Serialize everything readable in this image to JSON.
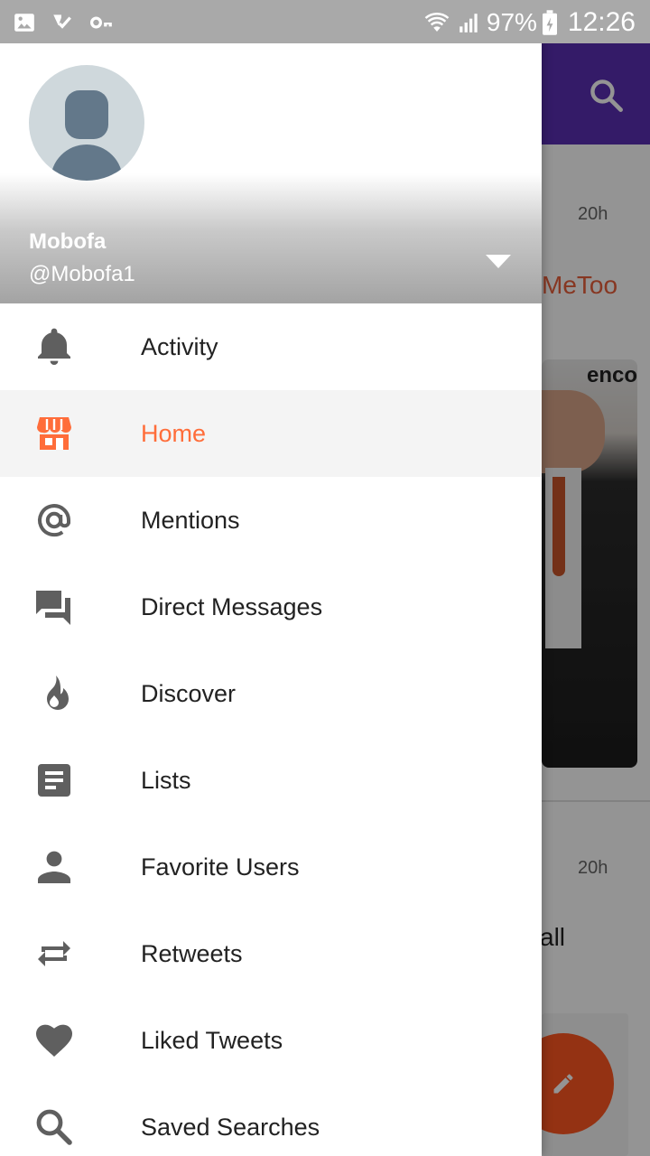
{
  "status_bar": {
    "battery_percent": "97%",
    "time": "12:26",
    "icons": [
      "image-icon",
      "check-icon",
      "key-icon",
      "wifi-icon",
      "signal-icon",
      "battery-charging-icon"
    ]
  },
  "background": {
    "search_icon": "search-icon",
    "timestamp_1": "20h",
    "hashtag_text": "MeToo",
    "photo_logo_text": "enco",
    "timestamp_2": "20h",
    "text_fragment": "all",
    "compose_icon": "pencil-icon"
  },
  "drawer": {
    "user": {
      "name": "Mobofa",
      "handle": "@Mobofa1"
    },
    "menu": [
      {
        "label": "Activity",
        "icon": "bell-icon",
        "active": false
      },
      {
        "label": "Home",
        "icon": "store-icon",
        "active": true
      },
      {
        "label": "Mentions",
        "icon": "at-icon",
        "active": false
      },
      {
        "label": "Direct Messages",
        "icon": "chat-icon",
        "active": false
      },
      {
        "label": "Discover",
        "icon": "flame-icon",
        "active": false
      },
      {
        "label": "Lists",
        "icon": "list-icon",
        "active": false
      },
      {
        "label": "Favorite Users",
        "icon": "person-icon",
        "active": false
      },
      {
        "label": "Retweets",
        "icon": "repeat-icon",
        "active": false
      },
      {
        "label": "Liked Tweets",
        "icon": "heart-icon",
        "active": false
      },
      {
        "label": "Saved Searches",
        "icon": "search-icon",
        "active": false
      }
    ]
  },
  "colors": {
    "accent": "#ff6d3a",
    "toolbar": "#5b2fb3",
    "icon_gray": "#5f5f5f",
    "fab": "#ff5722"
  }
}
